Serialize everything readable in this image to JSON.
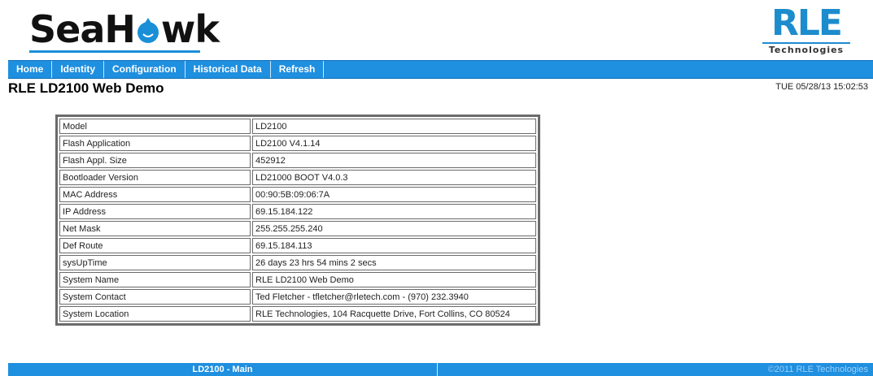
{
  "header": {
    "seahawk_logo_text": "SeaHawk",
    "rle_logo_letters": "RLE",
    "rle_logo_sub": "Technologies",
    "brand_color": "#1f8fe0"
  },
  "nav": {
    "items": [
      "Home",
      "Identity",
      "Configuration",
      "Historical Data",
      "Refresh"
    ]
  },
  "page": {
    "title": "RLE LD2100 Web Demo",
    "datetime": "TUE 05/28/13 15:02:53"
  },
  "table": {
    "rows": [
      {
        "key": "Model",
        "value": "LD2100"
      },
      {
        "key": "Flash Application",
        "value": "LD2100 V4.1.14"
      },
      {
        "key": "Flash Appl. Size",
        "value": "452912"
      },
      {
        "key": "Bootloader Version",
        "value": "LD21000 BOOT V4.0.3"
      },
      {
        "key": "MAC Address",
        "value": "00:90:5B:09:06:7A"
      },
      {
        "key": "IP Address",
        "value": "69.15.184.122"
      },
      {
        "key": "Net Mask",
        "value": "255.255.255.240"
      },
      {
        "key": "Def Route",
        "value": "69.15.184.113"
      },
      {
        "key": "sysUpTime",
        "value": "26 days 23 hrs 54 mins 2 secs"
      },
      {
        "key": "System Name",
        "value": "RLE LD2100 Web Demo"
      },
      {
        "key": "System Contact",
        "value": "Ted Fletcher - tfletcher@rletech.com - (970) 232.3940"
      },
      {
        "key": "System Location",
        "value": "RLE Technologies, 104 Racquette Drive, Fort Collins, CO 80524"
      }
    ]
  },
  "footer": {
    "left": "LD2100 - Main",
    "right": "©2011 RLE Technologies"
  }
}
